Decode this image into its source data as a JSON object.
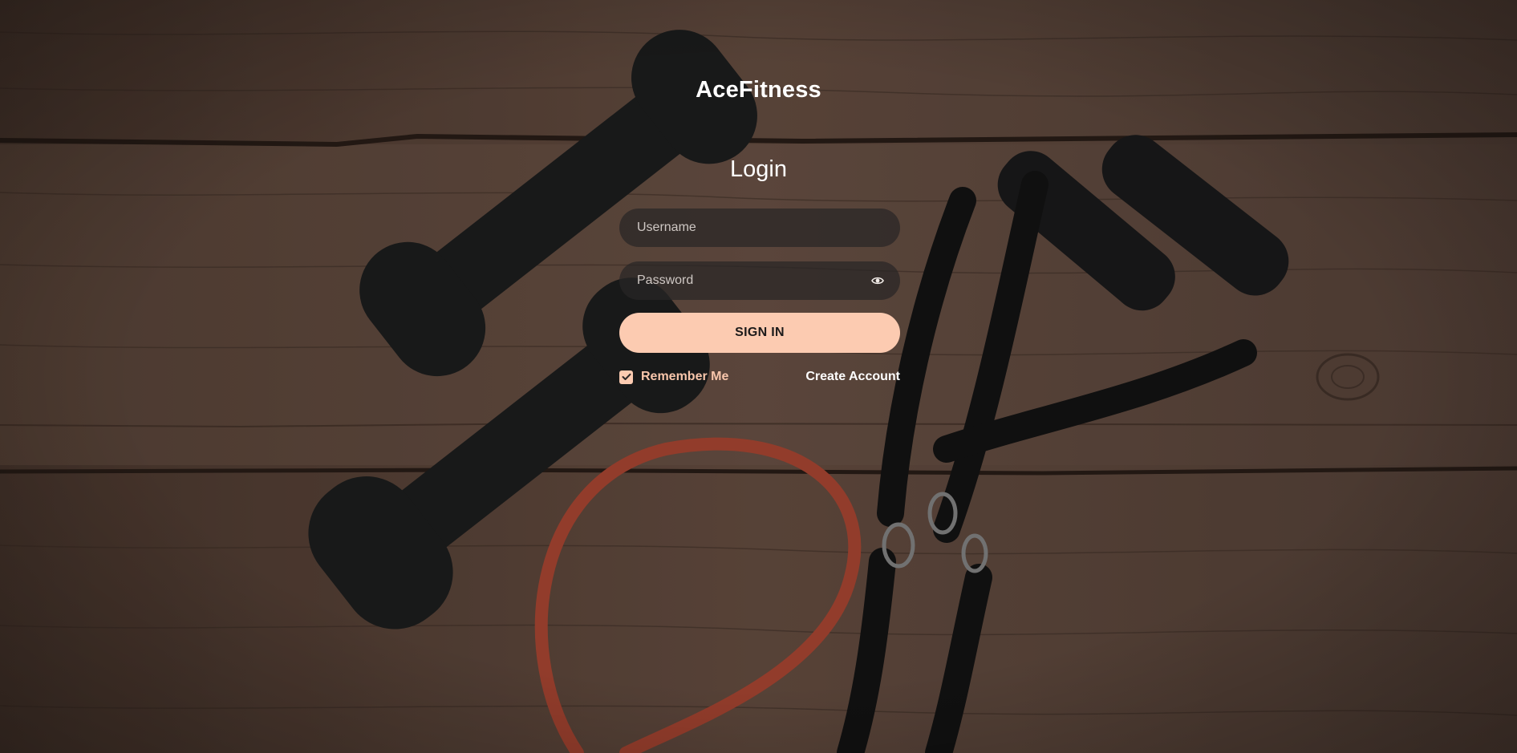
{
  "app": {
    "brand": "AceFitness"
  },
  "login": {
    "heading": "Login",
    "username_placeholder": "Username",
    "password_placeholder": "Password",
    "signin_label": "SIGN IN",
    "remember_label": "Remember Me",
    "remember_checked": true,
    "create_account_label": "Create Account"
  },
  "icons": {
    "password_toggle": "eye-icon",
    "remember_check": "checkmark-icon"
  },
  "colors": {
    "accent": "#fccbb1",
    "field_bg": "#282626",
    "text_light": "#ffffff"
  }
}
